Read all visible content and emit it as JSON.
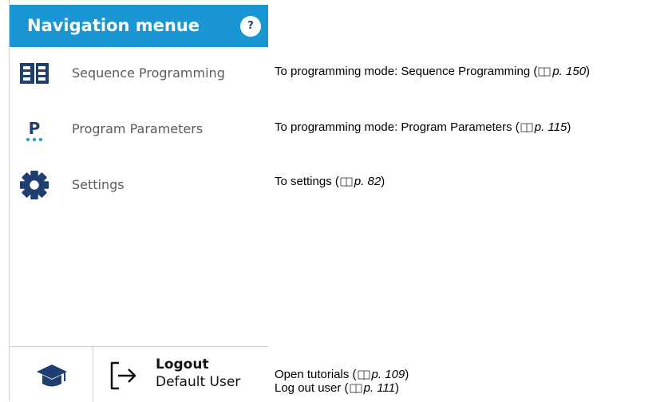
{
  "nav": {
    "title": "Navigation menue",
    "help_label": "?",
    "items": [
      {
        "label": "Sequence Programming",
        "icon": "sequence-programming-icon"
      },
      {
        "label": "Program Parameters",
        "icon": "program-parameters-icon",
        "icon_letter": "P"
      },
      {
        "label": "Settings",
        "icon": "gear-icon"
      }
    ],
    "footer": {
      "tutorial_icon": "graduation-cap-icon",
      "logout_icon": "logout-icon",
      "logout_label": "Logout",
      "user_name": "Default User"
    }
  },
  "annotations": [
    {
      "prefix": "To programming mode: Sequence Programming (",
      "page": "p. 150",
      "suffix": ")"
    },
    {
      "prefix": "To programming mode: Program Parameters (",
      "page": "p. 115",
      "suffix": ")"
    },
    {
      "prefix": "To settings (",
      "page": "p. 82",
      "suffix": ")"
    },
    {
      "prefix": "Open tutorials (",
      "page": "p. 109",
      "suffix": ")"
    },
    {
      "prefix": "Log out user (",
      "page": "p. 111",
      "suffix": ")"
    }
  ],
  "colors": {
    "header_bg": "#1a96d4",
    "icon_dark": "#1f3e71",
    "label_gray": "#5a5a5a"
  }
}
